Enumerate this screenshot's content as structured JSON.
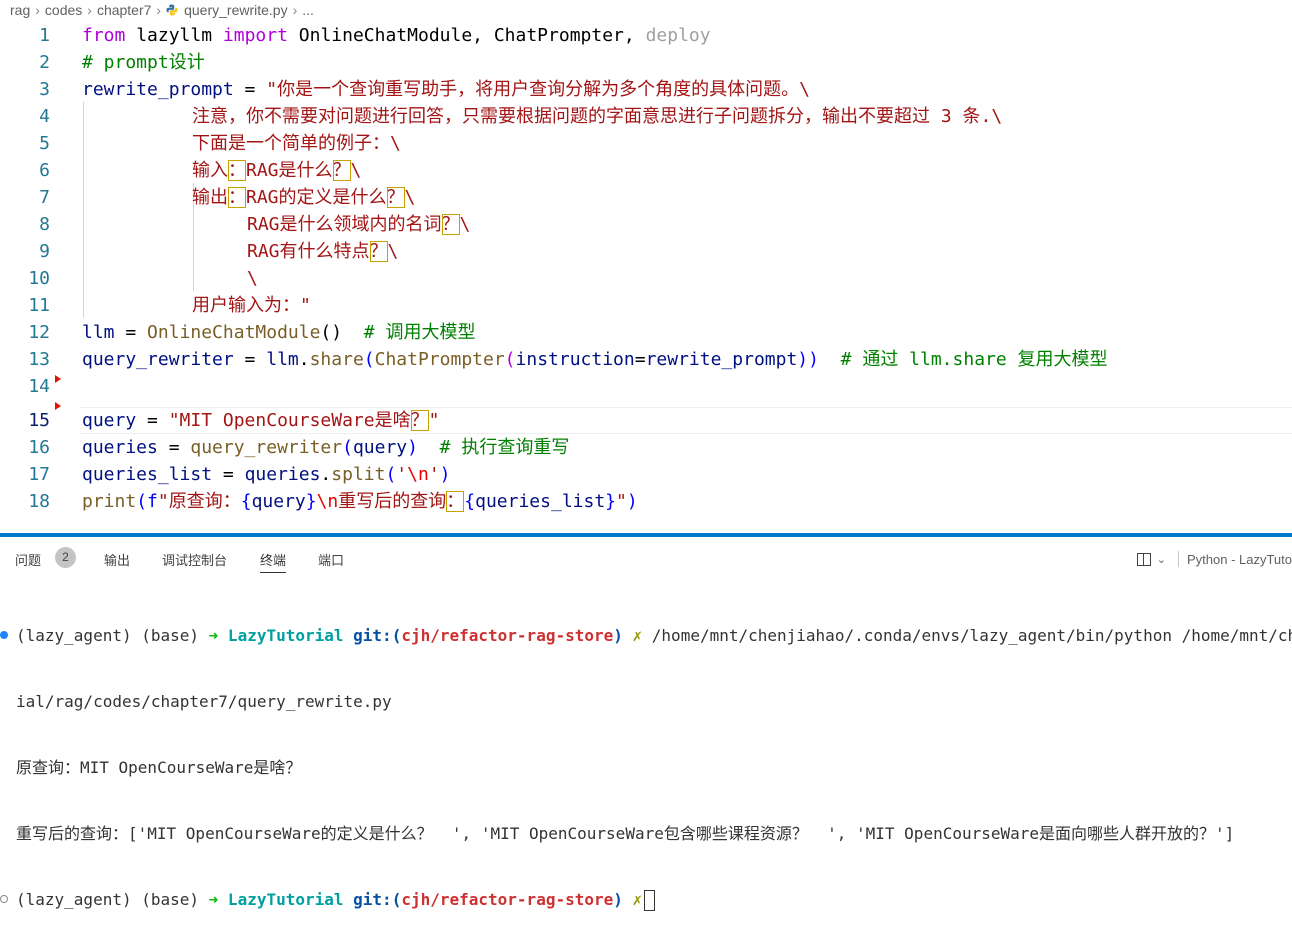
{
  "breadcrumb": {
    "items": [
      "rag",
      "codes",
      "chapter7",
      "query_rewrite.py",
      "..."
    ]
  },
  "editor": {
    "line_numbers": [
      "1",
      "2",
      "3",
      "4",
      "5",
      "6",
      "7",
      "8",
      "9",
      "10",
      "11",
      "12",
      "13",
      "14",
      "15",
      "16",
      "17",
      "18"
    ],
    "active_line": 15,
    "lines": {
      "l1": {
        "t1": "from",
        "t2": " lazyllm ",
        "t3": "import",
        "t4": " OnlineChatModule, ChatPrompter, ",
        "t5": "deploy"
      },
      "l2": {
        "t1": "# prompt设计"
      },
      "l3": {
        "t1": "rewrite_prompt",
        " t2": "",
        "t3": " = ",
        "t4": "\"你是一个查询重写助手，将用户查询分解为多个角度的具体问题。\\"
      },
      "l4": {
        "t1": "注意，你不需要对问题进行回答，只需要根据问题的字面意思进行子问题拆分，输出不要超过 3 条.\\"
      },
      "l5": {
        "t1": "下面是一个简单的例子：\\"
      },
      "l6": {
        "t1": "输入",
        "t2": "：",
        "t3": "RAG是什么",
        "t4": "？",
        "t5": "\\"
      },
      "l7": {
        "t1": "输出",
        "t2": "：",
        "t3": "RAG的定义是什么",
        "t4": "？",
        "t5": "\\"
      },
      "l8": {
        "t1": "RAG是什么领域内的名词",
        "t2": "？",
        "t3": "\\"
      },
      "l9": {
        "t1": "RAG有什么特点",
        "t2": "？",
        "t3": "\\"
      },
      "l10": {
        "t1": "\\"
      },
      "l11": {
        "t1": "用户输入为：\""
      },
      "l12": {
        "t1": "llm",
        " t2": "",
        "t3": " = ",
        "t4": "OnlineChatModule",
        "t5": "()",
        "t6": "  # 调用大模型"
      },
      "l13": {
        "t1": "query_rewriter",
        "t2": " = ",
        "t3": "llm",
        "t4": ".",
        "t5": "share",
        "t6": "(",
        "t7": "ChatPrompter",
        "t8": "(",
        "t9": "instruction",
        "t10": "=",
        "t11": "rewrite_prompt",
        "t12": "))",
        "t13": "  # 通过 llm.share 复用大模型"
      },
      "l15": {
        "t1": "query",
        "t2": " = ",
        "t3": "\"MIT OpenCourseWare是啥",
        "t4": "？",
        "t5": "\""
      },
      "l16": {
        "t1": "queries",
        "t2": " = ",
        "t3": "query_rewriter",
        "t4": "(",
        "t5": "query",
        "t6": ")",
        "t7": "  # 执行查询重写"
      },
      "l17": {
        "t1": "queries_list",
        "t2": " = ",
        "t3": "queries",
        "t4": ".",
        "t5": "split",
        "t6": "(",
        "t7": "'",
        "t8": "\\n",
        "t9": "'",
        "t10": ")"
      },
      "l18": {
        "t1": "print",
        "t2": "(",
        "t3": "f",
        "t4": "\"原查询：",
        "t5": "{",
        "t6": "query",
        "t7": "}",
        "t8": "\\n",
        "t9": "重写后的查询",
        "t10": "：",
        "t11": "{",
        "t12": "queries_list",
        "t13": "}",
        "t14": "\"",
        "t15": ")"
      }
    }
  },
  "panel": {
    "tabs": [
      "问题",
      "输出",
      "调试控制台",
      "终端",
      "端口"
    ],
    "active_tab": "终端",
    "problems_count": "2",
    "terminal_selector": "Python - LazyTuto"
  },
  "terminal": {
    "prompt_env": "(lazy_agent) (base) ",
    "arrow": "➜",
    "dir": " LazyTutorial ",
    "git_label": "git:(",
    "branch": "cjh/refactor-rag-store",
    "git_close": ")",
    "cross": " ✗",
    "cmd_line1": " /home/mnt/chenjiahao/.conda/envs/lazy_agent/bin/python /home/mnt/chenjiahao",
    "cmd_line2": "ial/rag/codes/chapter7/query_rewrite.py",
    "out1": "原查询：MIT OpenCourseWare是啥？",
    "out2": "重写后的查询：['MIT OpenCourseWare的定义是什么？  ', 'MIT OpenCourseWare包含哪些课程资源？  ', 'MIT OpenCourseWare是面向哪些人群开放的？']"
  },
  "colors": {
    "accent": "#007acc",
    "keyword": "#0000ff",
    "string": "#a31515",
    "comment": "#008000",
    "function": "#795e26",
    "variable": "#001080"
  }
}
